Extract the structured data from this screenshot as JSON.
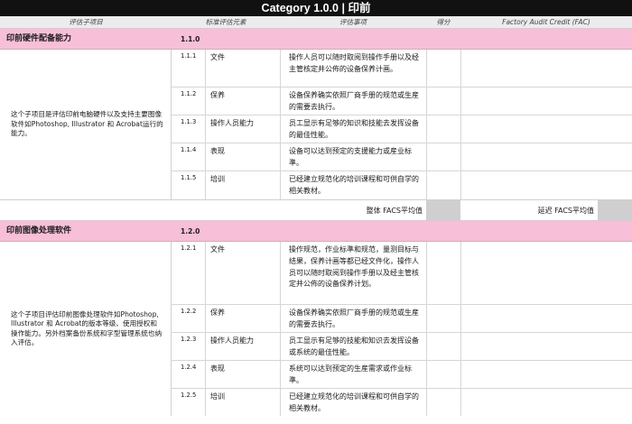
{
  "title": "Category 1.0.0 | 印前",
  "headers": {
    "sub_item": "评估子项目",
    "standard": "标准评估元素",
    "matter": "评估事项",
    "score": "得分",
    "fac": "Factory Audit Credit (FAC)"
  },
  "sections": [
    {
      "name": "印前硬件配备能力",
      "code": "1.1.0",
      "description": "这个子项目是评估印前电脑硬件以及支持主要图像软件如Photoshop, Illustrator 和 Acrobat运行的能力。",
      "items": [
        {
          "num": "1.1.1",
          "name": "文件",
          "text": "操作人员可以随时取阅到操作手册以及经主管核定并公佈的设备保养计画。"
        },
        {
          "num": "1.1.2",
          "name": "保养",
          "text": "设备保养确实依照厂商手册的规范或生産的需要去执行。"
        },
        {
          "num": "1.1.3",
          "name": "操作人员能力",
          "text": "员工显示有足够的知识和技能去发挥设备的最佳性能。"
        },
        {
          "num": "1.1.4",
          "name": "表现",
          "text": "设备可以达到预定的支援能力或産业标準。"
        },
        {
          "num": "1.1.5",
          "name": "培训",
          "text": "已经建立规范化的培训课程和可供自学的相关教材。"
        }
      ],
      "avg_facs": "整体 FACS平均值",
      "delay_facs": "延迟 FACS平均值"
    },
    {
      "name": "印前图像处理软件",
      "code": "1.2.0",
      "description": "这个子项目评估印前图像处理软件如Photoshop, Illustrator 和 Acrobat的版本等级、使用授权和操作能力。另外档案备份系统和字型管理系统也纳入评估。",
      "items": [
        {
          "num": "1.2.1",
          "name": "文件",
          "text": "操作规范，作业标準和规范，量测目标与结果，保养计画等都已经文件化，操作人员可以随时取阅到操作手册以及经主管核定并公佈的设备保养计划。"
        },
        {
          "num": "1.2.2",
          "name": "保养",
          "text": "设备保养确实依照厂商手册的规范或生産的需要去执行。"
        },
        {
          "num": "1.2.3",
          "name": "操作人员能力",
          "text": "员工显示有足够的技能和知识去发挥设备或系统的最佳性能。"
        },
        {
          "num": "1.2.4",
          "name": "表现",
          "text": "系统可以达到预定的生産需求或作业标準。"
        },
        {
          "num": "1.2.5",
          "name": "培训",
          "text": "已经建立规范化的培训课程和可供自学的相关教材。"
        }
      ]
    }
  ]
}
